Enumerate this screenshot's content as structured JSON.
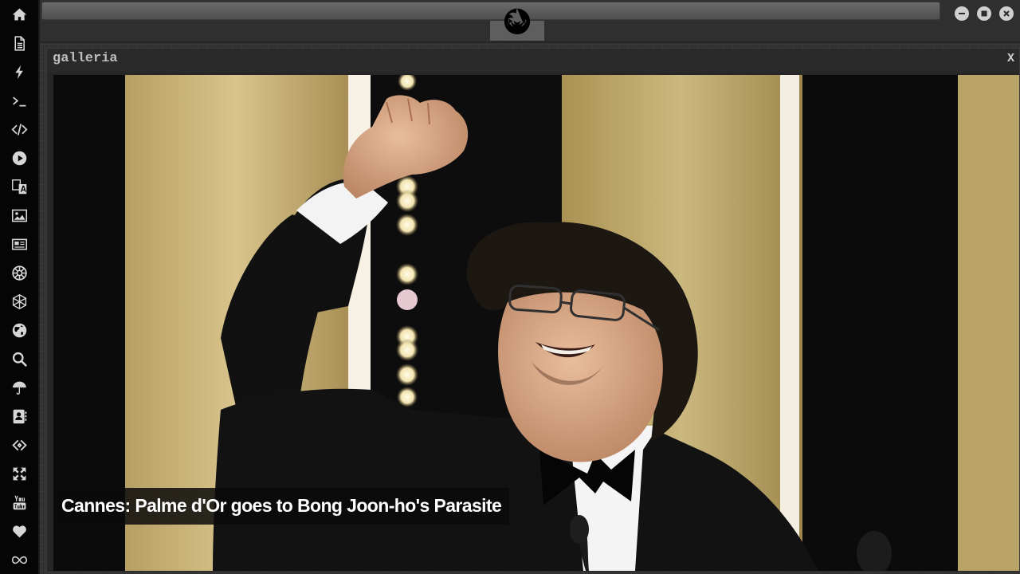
{
  "sidebar": {
    "items": [
      {
        "icon": "home-icon"
      },
      {
        "icon": "document-icon"
      },
      {
        "icon": "lightning-icon"
      },
      {
        "icon": "terminal-icon"
      },
      {
        "icon": "code-icon"
      },
      {
        "icon": "play-icon"
      },
      {
        "icon": "translate-icon"
      },
      {
        "icon": "image-icon"
      },
      {
        "icon": "newspaper-icon"
      },
      {
        "icon": "galactic-empire-icon"
      },
      {
        "icon": "hexagon-network-icon"
      },
      {
        "icon": "globe-icon"
      },
      {
        "icon": "search-icon"
      },
      {
        "icon": "umbrella-icon"
      },
      {
        "icon": "contacts-icon"
      },
      {
        "icon": "code-diamond-icon"
      },
      {
        "icon": "fullscreen-icon"
      },
      {
        "icon": "youtube-icon"
      },
      {
        "icon": "heart-icon"
      },
      {
        "icon": "infinity-icon"
      }
    ]
  },
  "topbar": {
    "logo_icon": "rebel-alliance-icon",
    "window_controls": [
      "minimize-icon",
      "maximize-icon",
      "close-icon"
    ]
  },
  "gallery": {
    "title": "galleria",
    "close_label": "X",
    "caption": "Cannes: Palme d'Or goes to Bong Joon-ho's Parasite"
  },
  "colors": {
    "sidebar_bg": "#050505",
    "icon": "#d6d6d6",
    "workspace_bg": "#323232",
    "backdrop_gold": "#c9b47a"
  }
}
